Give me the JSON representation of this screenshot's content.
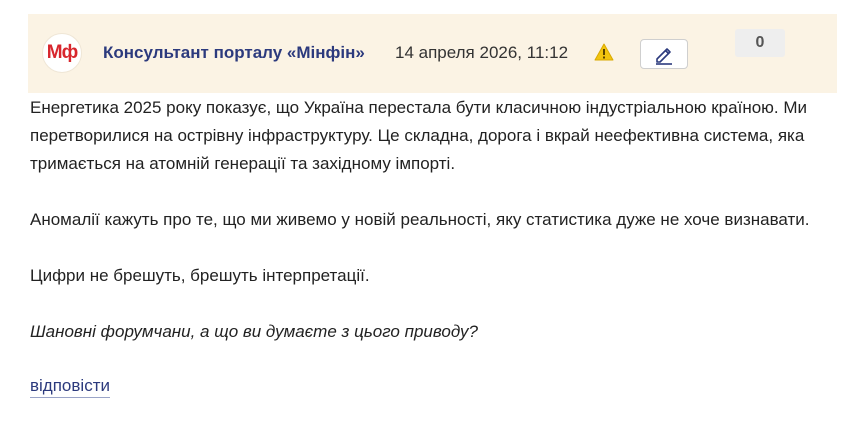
{
  "post": {
    "logo_text": "Мф",
    "author": "Консультант порталу «Мінфін»",
    "date": "14 апреля 2026, 11:12",
    "warning_icon": "warning-icon",
    "edit_icon": "pencil-icon",
    "counter": "0",
    "paragraphs": [
      "Енергетика 2025 року показує, що Україна перестала бути класичною індустріальною країною. Ми перетворилися на острівну інфраструктуру. Це складна, дорога і вкрай неефективна система, яка тримається на атомній генерації та західному імпорті.",
      "Аномалії кажуть про те, що ми живемо у новій реальності, яку статистика дуже не хоче визнавати.",
      "Цифри не брешуть, брешуть інтерпретації."
    ],
    "question": "Шановні форумчани, а що ви думаєте з цього приводу?",
    "reply_label": "відповісти"
  },
  "colors": {
    "header_bg": "#fbf3e4",
    "author": "#2c3a7d",
    "logo": "#d8262d",
    "warning": "#f2c40f"
  }
}
